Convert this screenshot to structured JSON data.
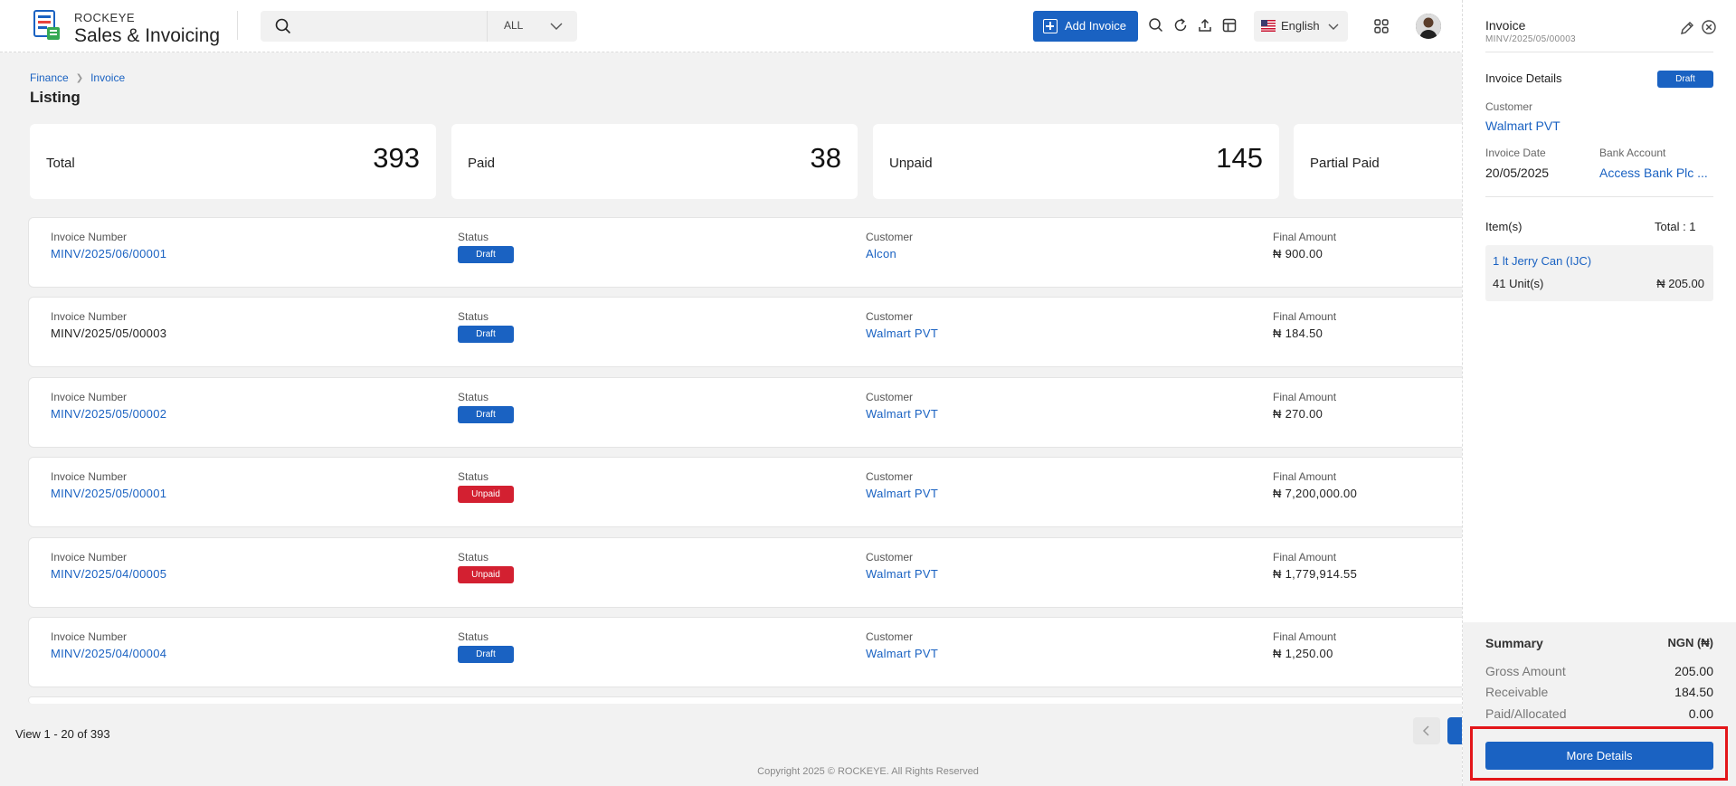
{
  "app": {
    "brand_top": "ROCKEYE",
    "brand_bottom": "Sales & Invoicing"
  },
  "header": {
    "search_placeholder": "",
    "scope": "ALL",
    "add_invoice": "Add Invoice",
    "language": "English"
  },
  "breadcrumb": [
    "Finance",
    "Invoice"
  ],
  "page_title": "Listing",
  "stats": [
    {
      "label": "Total",
      "value": "393"
    },
    {
      "label": "Paid",
      "value": "38"
    },
    {
      "label": "Unpaid",
      "value": "145"
    },
    {
      "label": "Partial Paid",
      "value": ""
    }
  ],
  "table": {
    "col_invoice": "Invoice Number",
    "col_status": "Status",
    "col_customer": "Customer",
    "col_amount": "Final Amount",
    "rows": [
      {
        "number": "MINV/2025/06/00001",
        "status": "Draft",
        "customer": "Alcon",
        "amount": "₦ 900.00"
      },
      {
        "number": "MINV/2025/05/00003",
        "status": "Draft",
        "customer": "Walmart PVT",
        "amount": "₦ 184.50"
      },
      {
        "number": "MINV/2025/05/00002",
        "status": "Draft",
        "customer": "Walmart PVT",
        "amount": "₦ 270.00"
      },
      {
        "number": "MINV/2025/05/00001",
        "status": "Unpaid",
        "customer": "Walmart PVT",
        "amount": "₦ 7,200,000.00"
      },
      {
        "number": "MINV/2025/04/00005",
        "status": "Unpaid",
        "customer": "Walmart PVT",
        "amount": "₦ 1,779,914.55"
      },
      {
        "number": "MINV/2025/04/00004",
        "status": "Draft",
        "customer": "Walmart PVT",
        "amount": "₦ 1,250.00"
      }
    ]
  },
  "footer": {
    "view_count": "View 1 - 20 of 393",
    "copyright": "Copyright 2025 © ROCKEYE. All Rights Reserved"
  },
  "panel": {
    "title": "Invoice",
    "subtitle": "MINV/2025/05/00003",
    "details_heading": "Invoice Details",
    "status": "Draft",
    "customer_label": "Customer",
    "customer": "Walmart PVT",
    "date_label": "Invoice Date",
    "date": "20/05/2025",
    "bank_label": "Bank Account",
    "bank": "Access Bank Plc ...",
    "items_label": "Item(s)",
    "items_total": "Total : 1",
    "item": {
      "name": "1 lt Jerry Can (IJC)",
      "units": "41 Unit(s)",
      "amount": "₦ 205.00"
    },
    "summary": {
      "title": "Summary",
      "currency": "NGN (₦)",
      "rows": [
        {
          "label": "Gross Amount",
          "value": "205.00"
        },
        {
          "label": "Receivable",
          "value": "184.50"
        },
        {
          "label": "Paid/Allocated",
          "value": "0.00"
        }
      ],
      "button": "More Details"
    }
  },
  "colors": {
    "primary": "#1a62c2",
    "danger": "#d32031",
    "highlight": "#e3161a"
  }
}
